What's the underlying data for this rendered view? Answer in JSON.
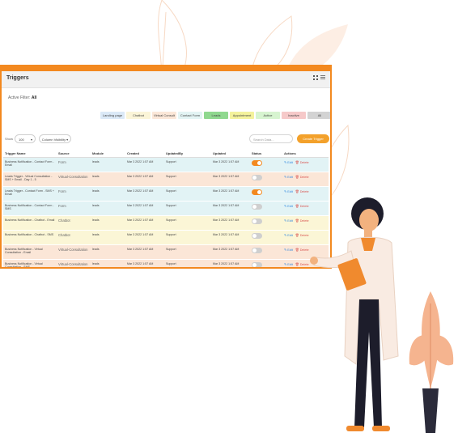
{
  "panel": {
    "title": "Triggers",
    "active_filter_label": "Active Filter:",
    "active_filter_value": "All"
  },
  "filters": [
    {
      "label": "Landing page",
      "color": "#dbe9f7"
    },
    {
      "label": "Chatbot",
      "color": "#fbf5d8"
    },
    {
      "label": "Virtual Consult",
      "color": "#fbe7d8"
    },
    {
      "label": "Contact Form",
      "color": "#e3f4f4"
    },
    {
      "label": "Leads",
      "color": "#8fd88f"
    },
    {
      "label": "Appointment",
      "color": "#f4f29c"
    },
    {
      "label": "Active",
      "color": "#d7f4d0"
    },
    {
      "label": "Inactive",
      "color": "#f6c9c9"
    },
    {
      "label": "All",
      "color": "#d3d3d3"
    }
  ],
  "toolbar": {
    "show_label": "Show",
    "show_value": "100",
    "column_visibility": "Column Visibility ▾",
    "search_placeholder": "Search Data...",
    "create_button": "Create Trigger"
  },
  "columns": [
    "Trigger Name",
    "Source",
    "Module",
    "Created",
    "UpdatedBy",
    "Updated",
    "Status",
    "Actions"
  ],
  "rows": [
    {
      "name": "Business Notification - Contact Form - Email",
      "source": "Form",
      "module": "leads",
      "created": "Mar 3 2022 1:57 AM",
      "updatedby": "Support",
      "updated": "Mar 3 2022 1:57 AM",
      "status": "on",
      "bg": "#e2f3f5"
    },
    {
      "name": "Leads Trigger - Virtual Consultation - SMS + Email - Day 1 - 5",
      "source": "Virtual-Consultation",
      "module": "leads",
      "created": "Mar 3 2022 1:57 AM",
      "updatedby": "Support",
      "updated": "Mar 3 2022 1:57 AM",
      "status": "off",
      "bg": "#fbe6d7"
    },
    {
      "name": "Leads Trigger - Contact Form - SMS + Email",
      "source": "Form",
      "module": "leads",
      "created": "Mar 3 2022 1:57 AM",
      "updatedby": "Support",
      "updated": "Mar 3 2022 1:57 AM",
      "status": "on",
      "bg": "#e2f3f5"
    },
    {
      "name": "Business Notification - Contact Form - SMS",
      "source": "Form",
      "module": "leads",
      "created": "Mar 3 2022 1:57 AM",
      "updatedby": "Support",
      "updated": "Mar 3 2022 1:57 AM",
      "status": "off",
      "bg": "#e2f3f5"
    },
    {
      "name": "Business Notification - Chatbot - Email",
      "source": "Chatbot",
      "module": "leads",
      "created": "Mar 3 2022 1:57 AM",
      "updatedby": "Support",
      "updated": "Mar 3 2022 1:57 AM",
      "status": "off",
      "bg": "#fbf6d6"
    },
    {
      "name": "Business Notification - Chatbot - SMS",
      "source": "Chatbot",
      "module": "leads",
      "created": "Mar 3 2022 1:57 AM",
      "updatedby": "Support",
      "updated": "Mar 3 2022 1:57 AM",
      "status": "off",
      "bg": "#fbf6d6"
    },
    {
      "name": "Business Notification - Virtual Consultation - Email",
      "source": "Virtual-Consultation",
      "module": "leads",
      "created": "Mar 3 2022 1:57 AM",
      "updatedby": "Support",
      "updated": "Mar 3 2022 1:57 AM",
      "status": "off",
      "bg": "#fbe6d7"
    },
    {
      "name": "Business Notification - Virtual Consultation - SMS",
      "source": "Virtual-Consultation",
      "module": "leads",
      "created": "Mar 3 2022 1:57 AM",
      "updatedby": "Support",
      "updated": "Mar 3 2022 1:57 AM",
      "status": "off",
      "bg": "#fbe6d7"
    }
  ],
  "actions": {
    "edit": "Edit",
    "delete": "Delete"
  },
  "colors": {
    "accent": "#f3891f",
    "edit": "#2e86de",
    "delete": "#d9534f"
  }
}
